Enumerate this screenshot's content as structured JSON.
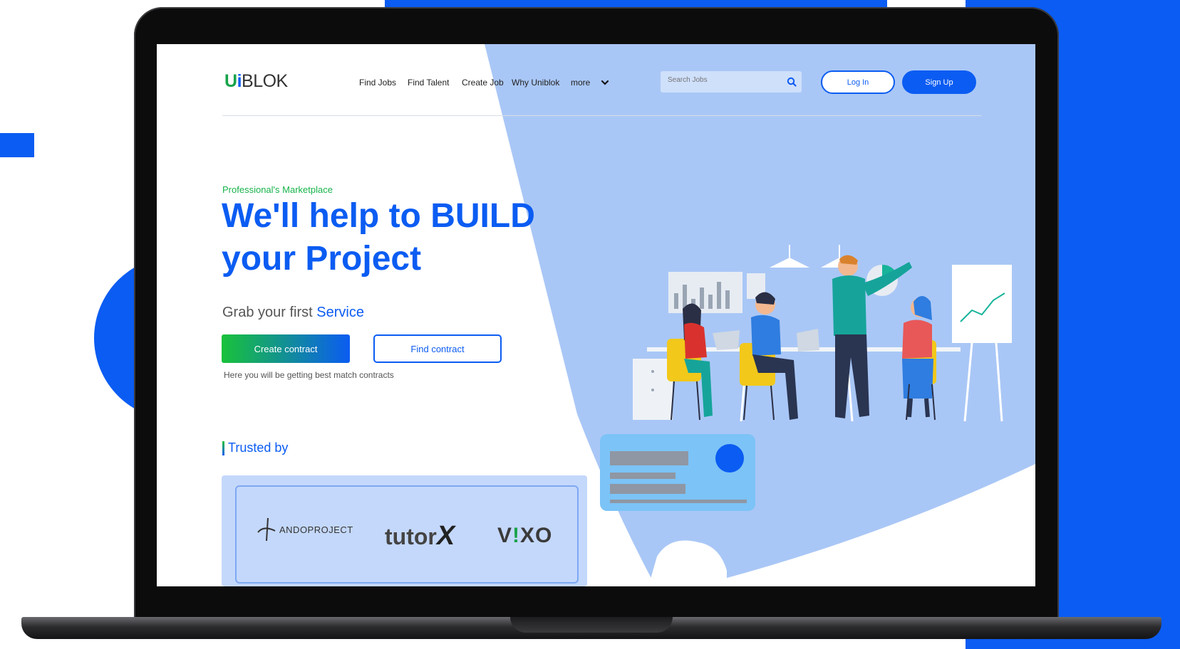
{
  "brand": {
    "logo_part1": "U",
    "logo_part2": "i",
    "logo_part3": "BLOK",
    "primary_color": "#0b5cf2",
    "accent_green": "#17b34a",
    "hero_shape_color": "#a9c7f6"
  },
  "nav": {
    "links": [
      "Find Jobs",
      "Find Talent",
      "Create Job",
      "Why Uniblok",
      "more"
    ],
    "more_icon": "chevron-down-icon",
    "search_placeholder": "Search Jobs",
    "search_icon": "search-icon",
    "login_label": "Log In",
    "signup_label": "Sign Up"
  },
  "hero": {
    "kicker": "Professional's Marketplace",
    "title_line1": "We'll help to BUILD",
    "title_line2": "your Project",
    "sub_text": "Grab your first ",
    "sub_accent": "Service",
    "create_label": "Create contract",
    "find_label": "Find contract",
    "note": "Here you will be getting best match contracts"
  },
  "trusted": {
    "title": "Trusted by",
    "logos": [
      "ANDOPROJECT",
      "tutor",
      "X",
      "V",
      "XO"
    ]
  },
  "illustration": {
    "name": "team-meeting-illustration"
  }
}
